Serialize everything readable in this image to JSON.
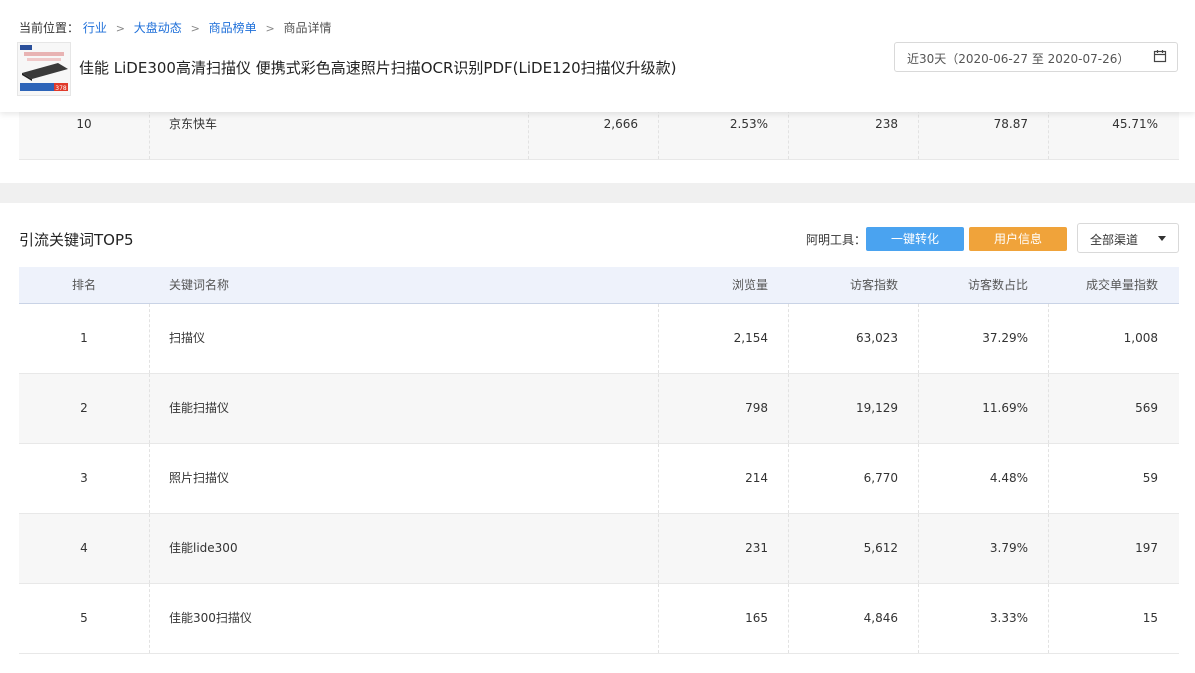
{
  "breadcrumb": {
    "label": "当前位置：",
    "items": [
      "行业",
      "大盘动态",
      "商品榜单"
    ],
    "current": "商品详情"
  },
  "product": {
    "title": "佳能 LiDE300高清扫描仪 便携式彩色高速照片扫描OCR识别PDF(LiDE120扫描仪升级款)",
    "thumb_price": "378"
  },
  "date_range": "近30天（2020-06-27 至 2020-07-26）",
  "prev_table_row": {
    "rank": "10",
    "name": "京东快车",
    "c1": "2,666",
    "c2": "2.53%",
    "c3": "238",
    "c4": "78.87",
    "c5": "45.71%"
  },
  "section": {
    "title": "引流关键词TOP5",
    "tools_label": "阿明工具：",
    "btn_convert": "一键转化",
    "btn_user": "用户信息",
    "channel": "全部渠道"
  },
  "table": {
    "headers": {
      "rank": "排名",
      "keyword": "关键词名称",
      "views": "浏览量",
      "visitors": "访客指数",
      "ratio": "访客数占比",
      "deals": "成交单量指数"
    },
    "rows": [
      {
        "rank": "1",
        "keyword": "扫描仪",
        "views": "2,154",
        "visitors": "63,023",
        "ratio": "37.29%",
        "deals": "1,008"
      },
      {
        "rank": "2",
        "keyword": "佳能扫描仪",
        "views": "798",
        "visitors": "19,129",
        "ratio": "11.69%",
        "deals": "569"
      },
      {
        "rank": "3",
        "keyword": "照片扫描仪",
        "views": "214",
        "visitors": "6,770",
        "ratio": "4.48%",
        "deals": "59"
      },
      {
        "rank": "4",
        "keyword": "佳能lide300",
        "views": "231",
        "visitors": "5,612",
        "ratio": "3.79%",
        "deals": "197"
      },
      {
        "rank": "5",
        "keyword": "佳能300扫描仪",
        "views": "165",
        "visitors": "4,846",
        "ratio": "3.33%",
        "deals": "15"
      }
    ]
  },
  "icons": {
    "calendar": "calendar-icon",
    "caret": "caret-down-icon",
    "breadcrumb_sep": "chevron-right-icon"
  },
  "colors": {
    "link": "#1e6fd9",
    "btn_convert": "#4aa3f0",
    "btn_user": "#f0a33a",
    "thead_bg": "#eef2fb"
  }
}
